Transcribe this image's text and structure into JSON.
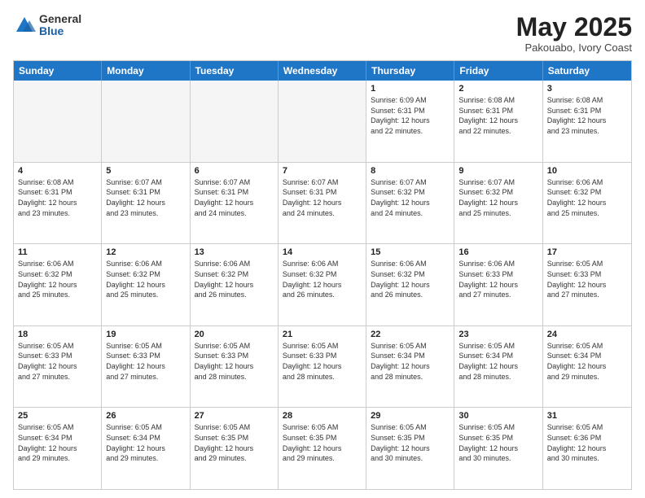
{
  "logo": {
    "general": "General",
    "blue": "Blue"
  },
  "header": {
    "month": "May 2025",
    "location": "Pakouabo, Ivory Coast"
  },
  "weekdays": [
    "Sunday",
    "Monday",
    "Tuesday",
    "Wednesday",
    "Thursday",
    "Friday",
    "Saturday"
  ],
  "weeks": [
    [
      {
        "day": "",
        "info": "",
        "shaded": true
      },
      {
        "day": "",
        "info": "",
        "shaded": true
      },
      {
        "day": "",
        "info": "",
        "shaded": true
      },
      {
        "day": "",
        "info": "",
        "shaded": true
      },
      {
        "day": "1",
        "info": "Sunrise: 6:09 AM\nSunset: 6:31 PM\nDaylight: 12 hours\nand 22 minutes.",
        "shaded": false
      },
      {
        "day": "2",
        "info": "Sunrise: 6:08 AM\nSunset: 6:31 PM\nDaylight: 12 hours\nand 22 minutes.",
        "shaded": false
      },
      {
        "day": "3",
        "info": "Sunrise: 6:08 AM\nSunset: 6:31 PM\nDaylight: 12 hours\nand 23 minutes.",
        "shaded": false
      }
    ],
    [
      {
        "day": "4",
        "info": "Sunrise: 6:08 AM\nSunset: 6:31 PM\nDaylight: 12 hours\nand 23 minutes.",
        "shaded": false
      },
      {
        "day": "5",
        "info": "Sunrise: 6:07 AM\nSunset: 6:31 PM\nDaylight: 12 hours\nand 23 minutes.",
        "shaded": false
      },
      {
        "day": "6",
        "info": "Sunrise: 6:07 AM\nSunset: 6:31 PM\nDaylight: 12 hours\nand 24 minutes.",
        "shaded": false
      },
      {
        "day": "7",
        "info": "Sunrise: 6:07 AM\nSunset: 6:31 PM\nDaylight: 12 hours\nand 24 minutes.",
        "shaded": false
      },
      {
        "day": "8",
        "info": "Sunrise: 6:07 AM\nSunset: 6:32 PM\nDaylight: 12 hours\nand 24 minutes.",
        "shaded": false
      },
      {
        "day": "9",
        "info": "Sunrise: 6:07 AM\nSunset: 6:32 PM\nDaylight: 12 hours\nand 25 minutes.",
        "shaded": false
      },
      {
        "day": "10",
        "info": "Sunrise: 6:06 AM\nSunset: 6:32 PM\nDaylight: 12 hours\nand 25 minutes.",
        "shaded": false
      }
    ],
    [
      {
        "day": "11",
        "info": "Sunrise: 6:06 AM\nSunset: 6:32 PM\nDaylight: 12 hours\nand 25 minutes.",
        "shaded": false
      },
      {
        "day": "12",
        "info": "Sunrise: 6:06 AM\nSunset: 6:32 PM\nDaylight: 12 hours\nand 25 minutes.",
        "shaded": false
      },
      {
        "day": "13",
        "info": "Sunrise: 6:06 AM\nSunset: 6:32 PM\nDaylight: 12 hours\nand 26 minutes.",
        "shaded": false
      },
      {
        "day": "14",
        "info": "Sunrise: 6:06 AM\nSunset: 6:32 PM\nDaylight: 12 hours\nand 26 minutes.",
        "shaded": false
      },
      {
        "day": "15",
        "info": "Sunrise: 6:06 AM\nSunset: 6:32 PM\nDaylight: 12 hours\nand 26 minutes.",
        "shaded": false
      },
      {
        "day": "16",
        "info": "Sunrise: 6:06 AM\nSunset: 6:33 PM\nDaylight: 12 hours\nand 27 minutes.",
        "shaded": false
      },
      {
        "day": "17",
        "info": "Sunrise: 6:05 AM\nSunset: 6:33 PM\nDaylight: 12 hours\nand 27 minutes.",
        "shaded": false
      }
    ],
    [
      {
        "day": "18",
        "info": "Sunrise: 6:05 AM\nSunset: 6:33 PM\nDaylight: 12 hours\nand 27 minutes.",
        "shaded": false
      },
      {
        "day": "19",
        "info": "Sunrise: 6:05 AM\nSunset: 6:33 PM\nDaylight: 12 hours\nand 27 minutes.",
        "shaded": false
      },
      {
        "day": "20",
        "info": "Sunrise: 6:05 AM\nSunset: 6:33 PM\nDaylight: 12 hours\nand 28 minutes.",
        "shaded": false
      },
      {
        "day": "21",
        "info": "Sunrise: 6:05 AM\nSunset: 6:33 PM\nDaylight: 12 hours\nand 28 minutes.",
        "shaded": false
      },
      {
        "day": "22",
        "info": "Sunrise: 6:05 AM\nSunset: 6:34 PM\nDaylight: 12 hours\nand 28 minutes.",
        "shaded": false
      },
      {
        "day": "23",
        "info": "Sunrise: 6:05 AM\nSunset: 6:34 PM\nDaylight: 12 hours\nand 28 minutes.",
        "shaded": false
      },
      {
        "day": "24",
        "info": "Sunrise: 6:05 AM\nSunset: 6:34 PM\nDaylight: 12 hours\nand 29 minutes.",
        "shaded": false
      }
    ],
    [
      {
        "day": "25",
        "info": "Sunrise: 6:05 AM\nSunset: 6:34 PM\nDaylight: 12 hours\nand 29 minutes.",
        "shaded": false
      },
      {
        "day": "26",
        "info": "Sunrise: 6:05 AM\nSunset: 6:34 PM\nDaylight: 12 hours\nand 29 minutes.",
        "shaded": false
      },
      {
        "day": "27",
        "info": "Sunrise: 6:05 AM\nSunset: 6:35 PM\nDaylight: 12 hours\nand 29 minutes.",
        "shaded": false
      },
      {
        "day": "28",
        "info": "Sunrise: 6:05 AM\nSunset: 6:35 PM\nDaylight: 12 hours\nand 29 minutes.",
        "shaded": false
      },
      {
        "day": "29",
        "info": "Sunrise: 6:05 AM\nSunset: 6:35 PM\nDaylight: 12 hours\nand 30 minutes.",
        "shaded": false
      },
      {
        "day": "30",
        "info": "Sunrise: 6:05 AM\nSunset: 6:35 PM\nDaylight: 12 hours\nand 30 minutes.",
        "shaded": false
      },
      {
        "day": "31",
        "info": "Sunrise: 6:05 AM\nSunset: 6:36 PM\nDaylight: 12 hours\nand 30 minutes.",
        "shaded": false
      }
    ]
  ]
}
